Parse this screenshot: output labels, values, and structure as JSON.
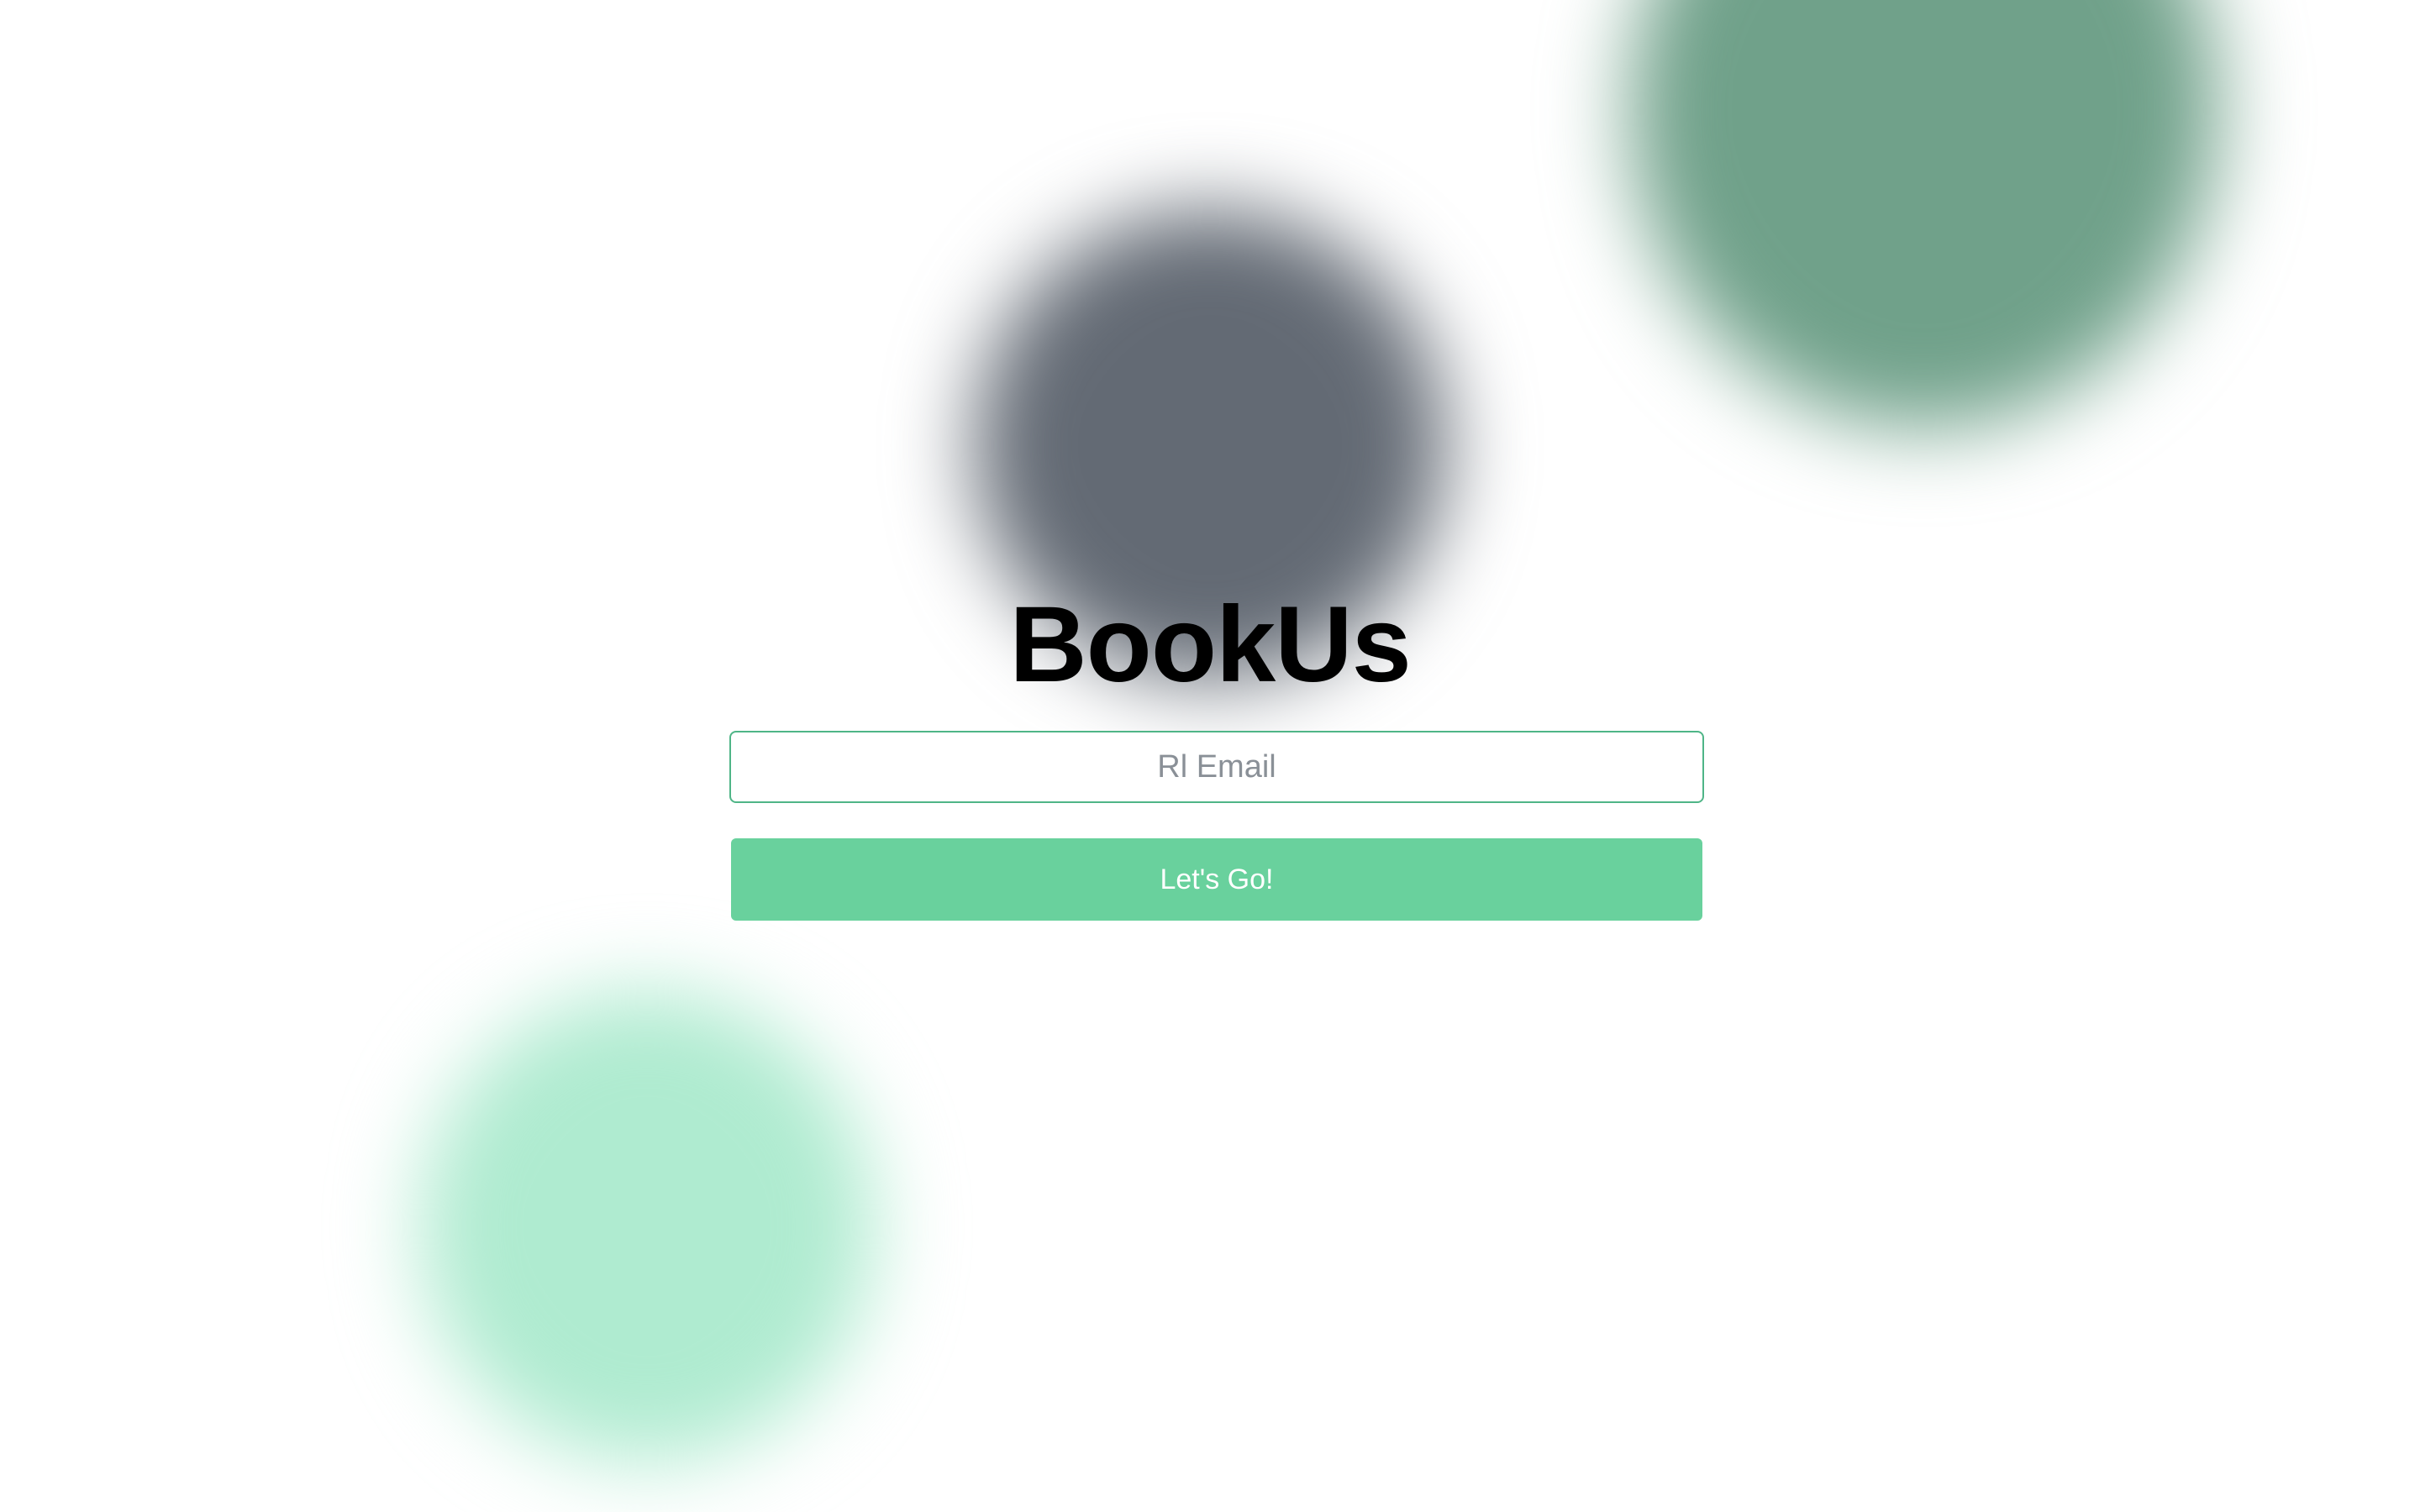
{
  "app": {
    "title": "BookUs"
  },
  "login_form": {
    "email_placeholder": "Rl Email",
    "email_value": "",
    "submit_label": "Let's Go!"
  },
  "theme": {
    "accent": "#69d19d",
    "input_border": "#4fb587",
    "blob_gray": "#636a74",
    "blob_dark_green": "#70a18a",
    "blob_light_green": "#afebd0"
  }
}
